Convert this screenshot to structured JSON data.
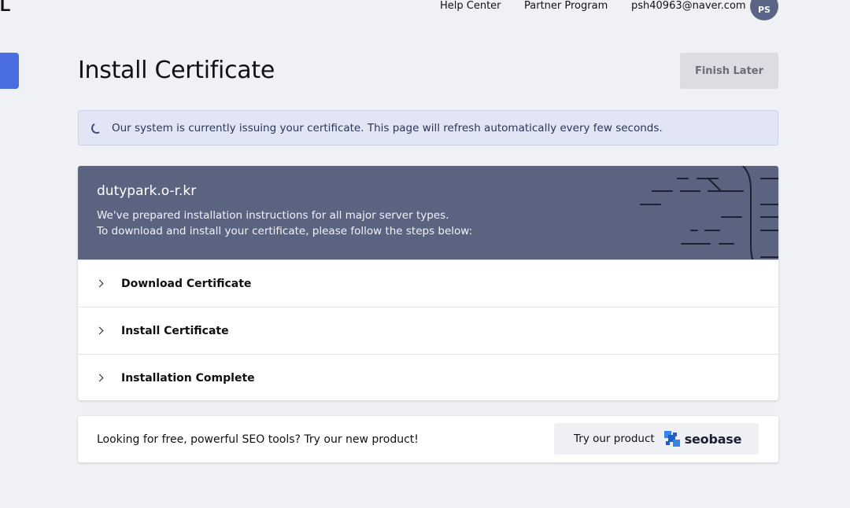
{
  "header": {
    "logo_fragment": "L",
    "help_label": "Help Center",
    "partner_label": "Partner Program",
    "email": "psh40963@naver.com",
    "avatar_initials": "PS"
  },
  "page": {
    "title": "Install Certificate",
    "finish_label": "Finish Later"
  },
  "notice": {
    "text": "Our system is currently issuing your certificate. This page will refresh automatically every few seconds."
  },
  "card": {
    "domain": "dutypark.o-r.kr",
    "line1": "We've prepared installation instructions for all major server types.",
    "line2": "To download and install your certificate, please follow the steps below:",
    "steps": [
      {
        "label": "Download Certificate"
      },
      {
        "label": "Install Certificate"
      },
      {
        "label": "Installation Complete"
      }
    ]
  },
  "promo": {
    "text": "Looking for free, powerful SEO tools? Try our new product!",
    "button_label": "Try our product",
    "brand": "seobase"
  },
  "colors": {
    "accent": "#4a6ee0",
    "header_bg": "#5a6380",
    "notice_bg": "#e1e5f4",
    "avatar_bg": "#5b6585"
  }
}
